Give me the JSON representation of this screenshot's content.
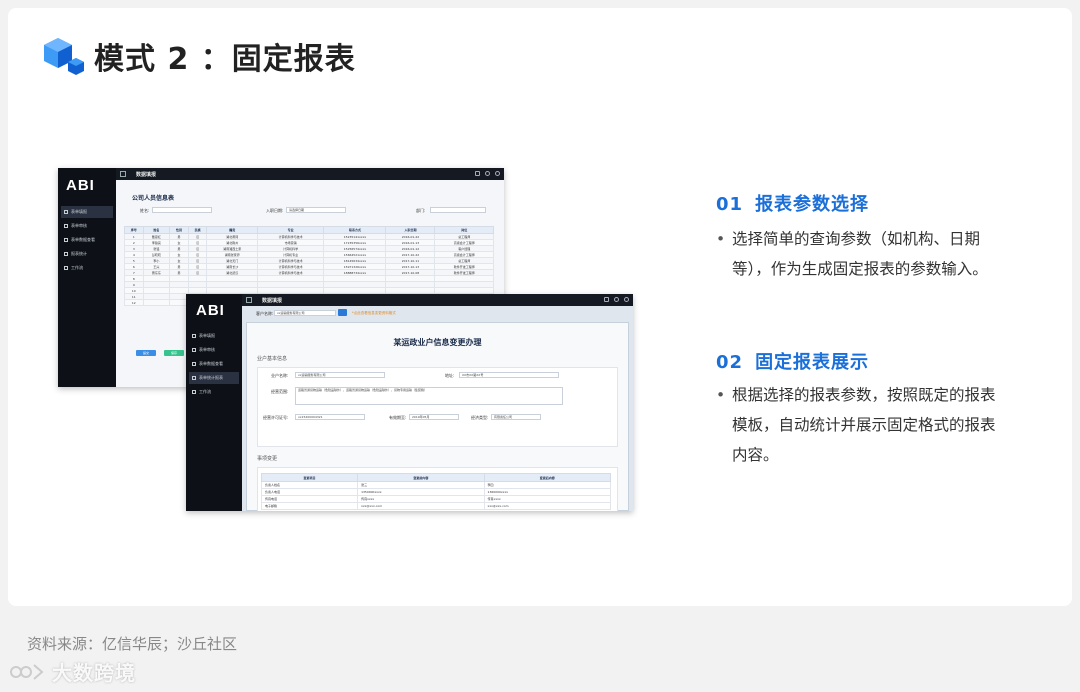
{
  "page_title": "模式 2 ：固定报表",
  "colors": {
    "accent": "#1a6fd8",
    "cube_light": "#3d9bf5",
    "cube_dark": "#1160d2",
    "sidebar": "#0d1117"
  },
  "shot1": {
    "logo": "ABI",
    "window_title": "数据填报",
    "nav": [
      "表单填报",
      "表单审核",
      "表单数据查看",
      "报表统计",
      "工作流"
    ],
    "report_title": "公司人员信息表",
    "filters": {
      "name_label": "姓名:",
      "date_label": "入职日期:",
      "date_value": "请选择日期",
      "dept_label": "部门:"
    },
    "columns": [
      "序号",
      "姓名",
      "性别",
      "民族",
      "籍贯",
      "专业",
      "联系方式",
      "入职日期",
      "岗位"
    ],
    "rows": [
      [
        "1",
        "戴思红",
        "男",
        "汉",
        "湖北黄冈",
        "计算机科学与技术",
        "15235141xxxx",
        "2016-01-22",
        "总工程师"
      ],
      [
        "2",
        "李锦亮",
        "女",
        "汉",
        "湖北荆州",
        "市场营销",
        "17235356xxxx",
        "2016-01-13",
        "高级会计工程师"
      ],
      [
        "3",
        "张铭",
        "男",
        "汉",
        "湖南湘西土家",
        "计算机科学",
        "15256574xxxx",
        "2016-01-12",
        "客户经理"
      ],
      [
        "4",
        "彭晓晓",
        "女",
        "汉",
        "湖南张家界",
        "计算机专业",
        "15664521xxxx",
        "2017-10-22",
        "高级会计工程师"
      ],
      [
        "5",
        "李小",
        "女",
        "汉",
        "湖北天门",
        "计算机科学与技术",
        "18145634xxxx",
        "2017-10-11",
        "总工程师"
      ],
      [
        "6",
        "王兴",
        "男",
        "汉",
        "湖南长沙",
        "计算机科学与技术",
        "15971326xxxx",
        "2017-10-13",
        "软件开发工程师"
      ],
      [
        "7",
        "曹东东",
        "男",
        "汉",
        "湖北武汉",
        "计算机科学与技术",
        "18888734xxxx",
        "2017-10-08",
        "软件开发工程师"
      ],
      [
        "8",
        "",
        "",
        "",
        "",
        "",
        "",
        "",
        ""
      ],
      [
        "9",
        "",
        "",
        "",
        "",
        "",
        "",
        "",
        ""
      ],
      [
        "10",
        "",
        "",
        "",
        "",
        "",
        "",
        "",
        ""
      ],
      [
        "11",
        "",
        "",
        "",
        "",
        "",
        "",
        "",
        ""
      ],
      [
        "12",
        "",
        "",
        "",
        "",
        "",
        "",
        "",
        ""
      ]
    ],
    "buttons": [
      "提交",
      "保存"
    ]
  },
  "shot2": {
    "logo": "ABI",
    "window_title": "数据填报",
    "nav": [
      "表单填报",
      "表单审核",
      "表单数据查看",
      "表单统计报表",
      "工作流"
    ],
    "company_label": "客户名称:",
    "company_value": "xx运输服务有限公司",
    "warning": "*点此查看信息变更资料格式",
    "form_title": "某运政业户信息变更办理",
    "section1": "业户基本信息",
    "fields": {
      "company_name_label": "业户名称:",
      "company_name_value": "xx运输服务有限公司",
      "address_label": "地址:",
      "address_value": "XX市XX路XX号",
      "scope_label": "经营范围:",
      "scope_value": "道路普通货物运输（危险品除外），道路普通货物运输（危险品除外），货物专用运输（集装箱）",
      "permit_label": "经营许可证号:",
      "permit_value": "xx15200004321",
      "date_label": "有效期至:",
      "date_value": "2019年05月",
      "type_label": "经济类型:",
      "type_value": "有限责任公司"
    },
    "section2": "事项变更",
    "change_columns": [
      "变更项目",
      "变更前内容",
      "变更后内容"
    ],
    "change_rows": [
      [
        "负责人姓名",
        "张三",
        "李四"
      ],
      [
        "负责人电话",
        "1350000xxxx",
        "1360000xxxx"
      ],
      [
        "传真电话",
        "传真xxxx",
        "传真xxxx"
      ],
      [
        "电子邮箱",
        "xxx@xxx.com",
        "xxx@xxx.com"
      ]
    ]
  },
  "sections": [
    {
      "num": "01",
      "title": "报表参数选择",
      "body": "选择简单的查询参数（如机构、日期等），作为生成固定报表的参数输入。"
    },
    {
      "num": "02",
      "title": "固定报表展示",
      "body": "根据选择的报表参数，按照既定的报表模板，自动统计并展示固定格式的报表内容。"
    }
  ],
  "source": "资料来源：亿信华辰；沙丘社区",
  "watermark": "大数跨境"
}
